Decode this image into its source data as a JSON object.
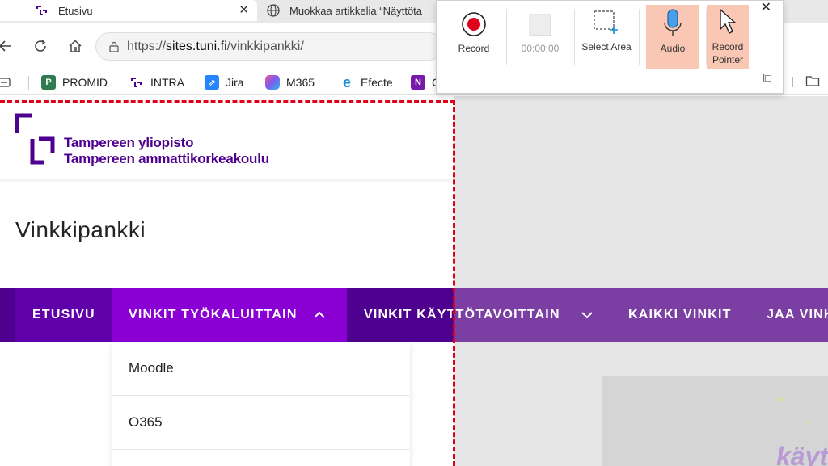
{
  "browser": {
    "tabs": [
      {
        "title": "Etusivu",
        "icon": "tuni-icon",
        "active": true
      },
      {
        "title": "Muokkaa artikkelia “Näyttöta",
        "icon": "globe-icon",
        "active": false
      }
    ],
    "url": {
      "prefix": "https://",
      "host": "sites.tuni.fi",
      "path": "/vinkkipankki/"
    },
    "bookmarks": [
      {
        "label": "PROMID",
        "icon": "promid-icon",
        "color": "#2f7a4e"
      },
      {
        "label": "INTRA",
        "icon": "tuni-icon",
        "color": "#4e008e"
      },
      {
        "label": "Jira",
        "icon": "jira-icon",
        "color": "#2684ff"
      },
      {
        "label": "M365",
        "icon": "m365-icon",
        "color": "#e8578f"
      },
      {
        "label": "Efecte",
        "icon": "edge-icon",
        "color": "#1a8fd6"
      },
      {
        "label": "C",
        "icon": "onenote-icon",
        "color": "#7719aa"
      }
    ]
  },
  "recorder": {
    "record_label": "Record",
    "timer": "00:00:00",
    "select_area_label": "Select Area",
    "audio_label": "Audio",
    "record_pointer_label": "Record Pointer"
  },
  "site": {
    "logo_line1": "Tampereen yliopisto",
    "logo_line2": "Tampereen ammattikorkeakoulu",
    "title": "Vinkkipankki",
    "menu": [
      {
        "label": "ETUSIVU"
      },
      {
        "label": "VINKIT TYÖKALUITTAIN",
        "expanded": true
      },
      {
        "label": "VINKIT KÄYTTÖTAVOITTAIN"
      },
      {
        "label": "KAIKKI VINKIT"
      },
      {
        "label": "JAA VINK"
      }
    ],
    "dropdown": [
      "Moodle",
      "O365"
    ],
    "hero_text": "käyt"
  },
  "colors": {
    "brand": "#4e008e",
    "menu_active": "#8a00d4",
    "recorder_active": "#f9c7b3",
    "record_red": "#e0001a"
  }
}
